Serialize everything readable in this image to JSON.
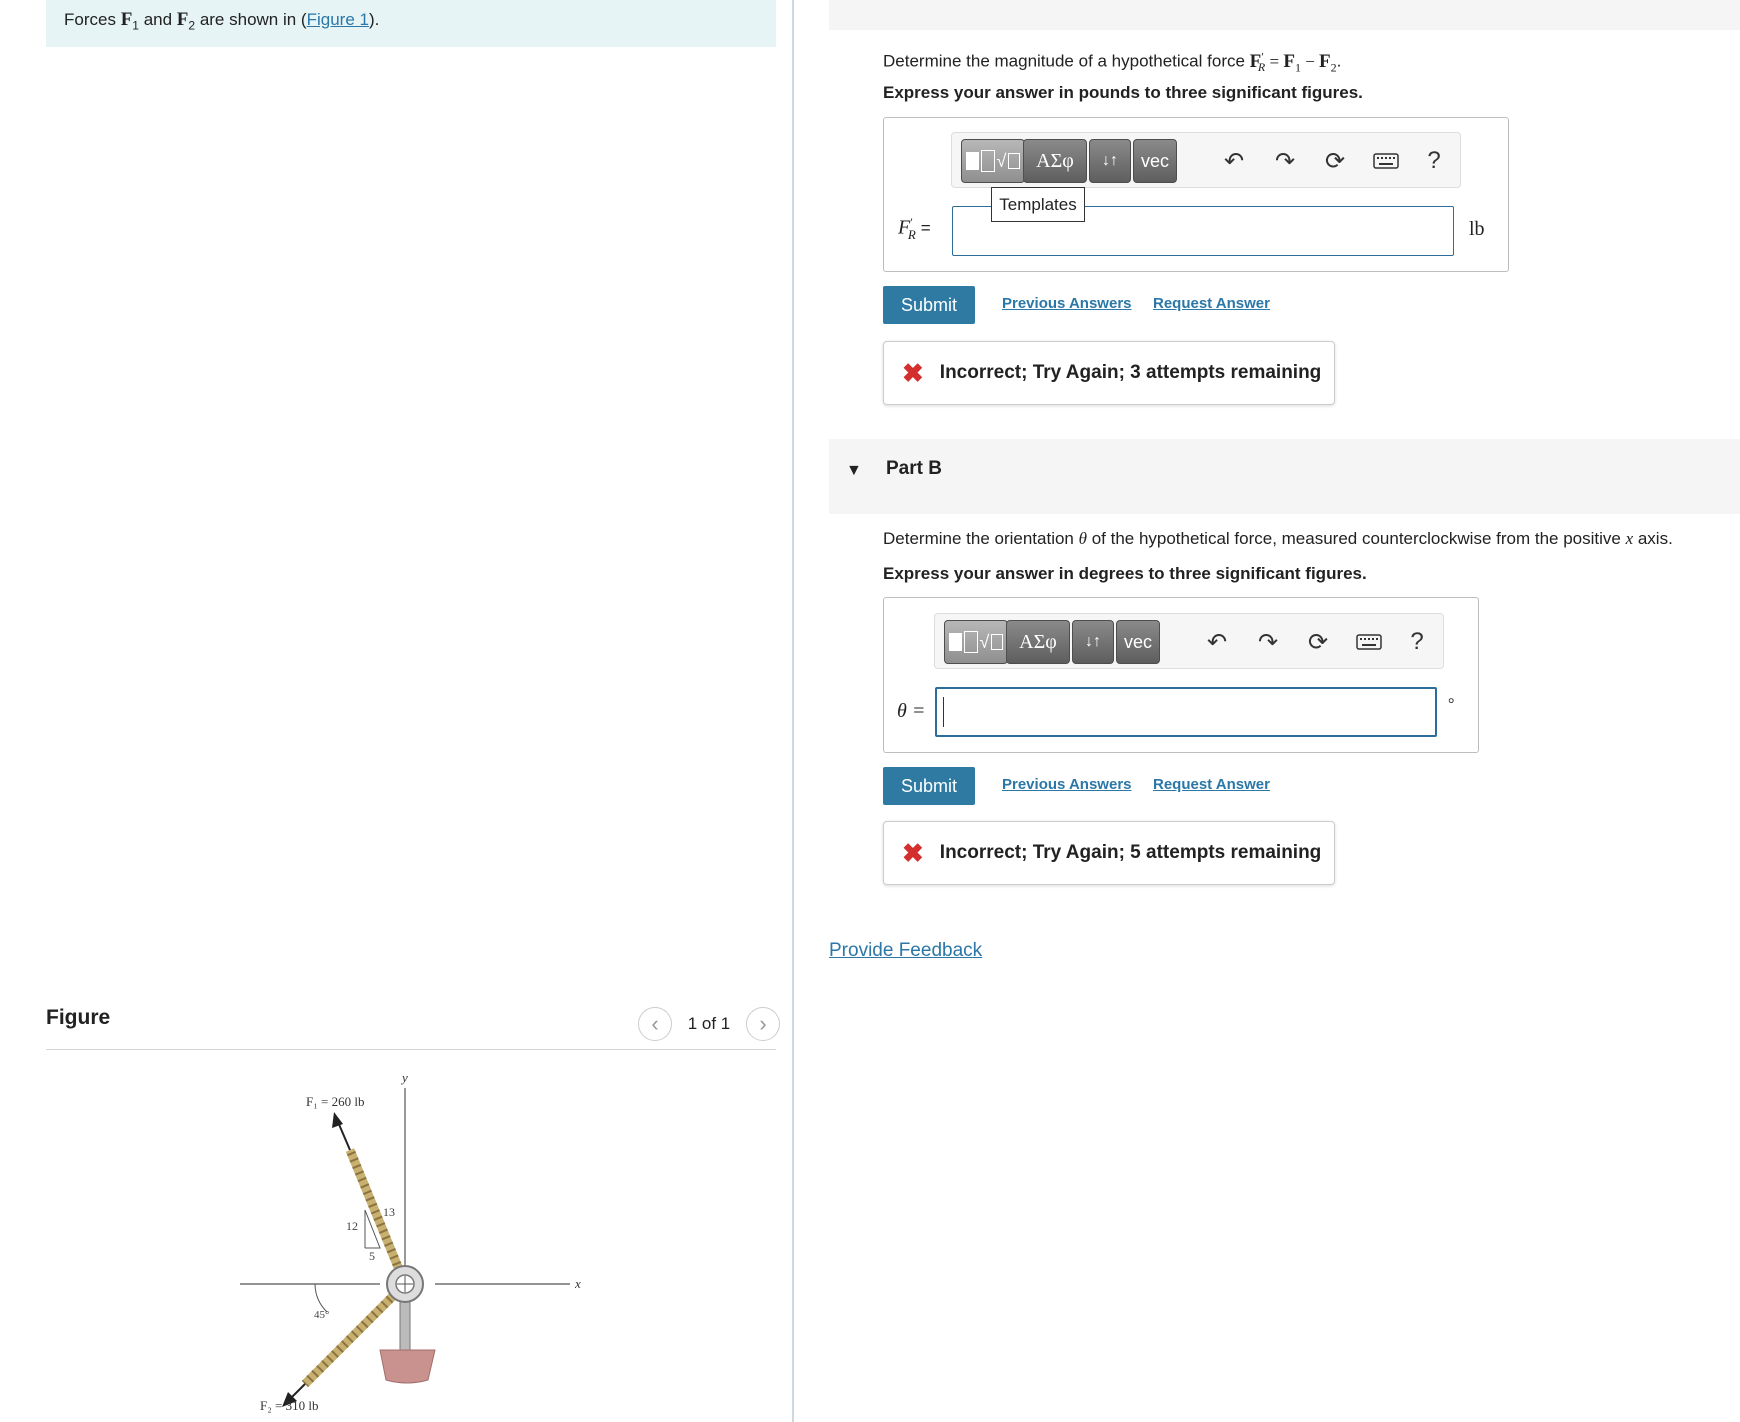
{
  "intro": {
    "prefix": "Forces ",
    "f1": "F",
    "f1_sub": "1",
    "and": " and ",
    "f2": "F",
    "f2_sub": "2",
    "mid": " are shown in (",
    "figure_link": "Figure 1",
    "suffix": ")."
  },
  "figure": {
    "heading": "Figure",
    "prev_icon": "chevron-left-icon",
    "next_icon": "chevron-right-icon",
    "counter": "1 of 1",
    "labels": {
      "f1": "F₁ = 260 lb",
      "f2": "F₂ = 310 lb",
      "y_axis": "y",
      "x_axis": "x",
      "side_12": "12",
      "side_13": "13",
      "side_5": "5",
      "angle": "45°"
    }
  },
  "part_a": {
    "question_prefix": "Determine the magnitude of a hypothetical force ",
    "question_math": "F′R = F1 − F2",
    "question_suffix": ".",
    "instructions": "Express your answer in pounds to three significant figures.",
    "toolbar": {
      "templates_icon": "templates-icon",
      "greek": "ΑΣφ",
      "arrows": "↓↑",
      "vec": "vec",
      "undo_icon": "undo-icon",
      "redo_icon": "redo-icon",
      "reset_icon": "reset-icon",
      "keyboard_icon": "keyboard-icon",
      "help": "?"
    },
    "tooltip": "Templates",
    "var_label": "F′R =",
    "input_value": "",
    "unit": "lb",
    "submit": "Submit",
    "previous_answers": "Previous Answers",
    "request_answer": "Request Answer",
    "feedback": "Incorrect; Try Again; 3 attempts remaining"
  },
  "part_b": {
    "title": "Part B",
    "question_prefix": "Determine the orientation ",
    "theta": "θ",
    "question_mid": " of the hypothetical force, measured counterclockwise from the positive ",
    "x": "x",
    "question_suffix": " axis.",
    "instructions": "Express your answer in degrees to three significant figures.",
    "toolbar": {
      "greek": "ΑΣφ",
      "arrows": "↓↑",
      "vec": "vec",
      "help": "?"
    },
    "var_label": "θ =",
    "input_value": "",
    "unit": "°",
    "submit": "Submit",
    "previous_answers": "Previous Answers",
    "request_answer": "Request Answer",
    "feedback": "Incorrect; Try Again; 5 attempts remaining"
  },
  "provide_feedback": "Provide Feedback",
  "colors": {
    "accent": "#2e7aa3",
    "link": "#2a77a8",
    "error": "#d32f2f",
    "intro_bg": "#e6f4f5"
  }
}
